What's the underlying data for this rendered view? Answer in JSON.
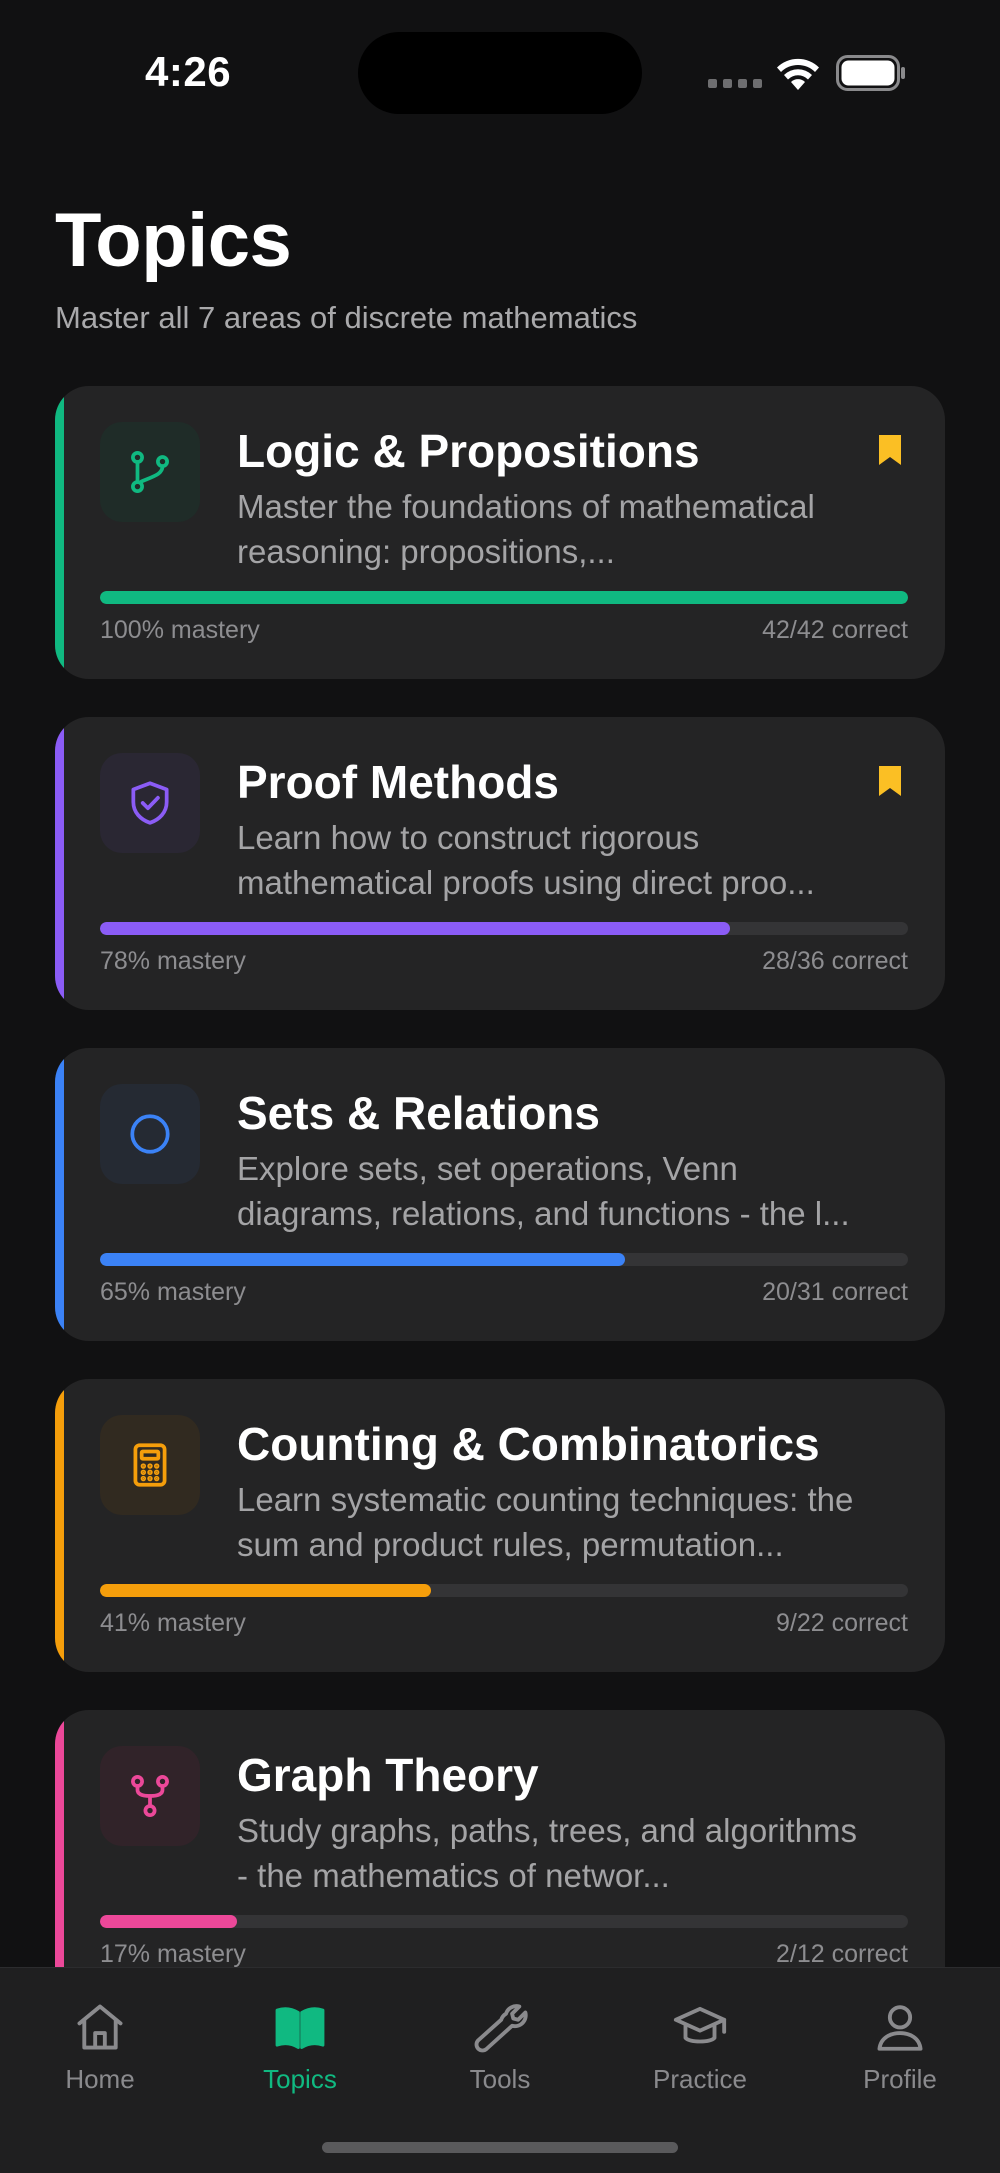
{
  "status_bar": {
    "time": "4:26"
  },
  "header": {
    "title": "Topics",
    "subtitle": "Master all 7 areas of discrete mathematics"
  },
  "topics": [
    {
      "title": "Logic & Propositions",
      "description": "Master the foundations of mathematical reasoning: propositions,...",
      "mastery_label": "100% mastery",
      "mastery": 1.0,
      "correct_label": "42/42 correct",
      "bookmarked": true,
      "icon": "git-branch-icon",
      "accent_color": "#10b981",
      "icon_bg": "#1f2c28"
    },
    {
      "title": "Proof Methods",
      "description": "Learn how to construct rigorous mathematical proofs using direct proo...",
      "mastery_label": "78% mastery",
      "mastery": 0.78,
      "correct_label": "28/36 correct",
      "bookmarked": true,
      "icon": "shield-check-icon",
      "accent_color": "#8b5cf6",
      "icon_bg": "#2a2733"
    },
    {
      "title": "Sets & Relations",
      "description": "Explore sets, set operations, Venn diagrams, relations, and functions - the l...",
      "mastery_label": "65% mastery",
      "mastery": 0.65,
      "correct_label": "20/31 correct",
      "bookmarked": false,
      "icon": "circle-icon",
      "accent_color": "#3b82f6",
      "icon_bg": "#252a33"
    },
    {
      "title": "Counting & Combinatorics",
      "description": "Learn systematic counting techniques: the sum and product rules, permutation...",
      "mastery_label": "41% mastery",
      "mastery": 0.41,
      "correct_label": "9/22 correct",
      "bookmarked": false,
      "icon": "calculator-icon",
      "accent_color": "#f59e0b",
      "icon_bg": "#312a20"
    },
    {
      "title": "Graph Theory",
      "description": "Study graphs, paths, trees, and algorithms - the mathematics of networ...",
      "mastery_label": "17% mastery",
      "mastery": 0.17,
      "correct_label": "2/12 correct",
      "bookmarked": false,
      "icon": "graph-fork-icon",
      "accent_color": "#ec4899",
      "icon_bg": "#312329"
    }
  ],
  "bookmark_color": "#fbbf24",
  "tab_bar": {
    "active_color": "#10b981",
    "tabs": [
      {
        "label": "Home",
        "icon": "home-icon",
        "active": false
      },
      {
        "label": "Topics",
        "icon": "book-open-icon",
        "active": true
      },
      {
        "label": "Tools",
        "icon": "wrench-icon",
        "active": false
      },
      {
        "label": "Practice",
        "icon": "graduation-cap-icon",
        "active": false
      },
      {
        "label": "Profile",
        "icon": "user-icon",
        "active": false
      }
    ]
  }
}
